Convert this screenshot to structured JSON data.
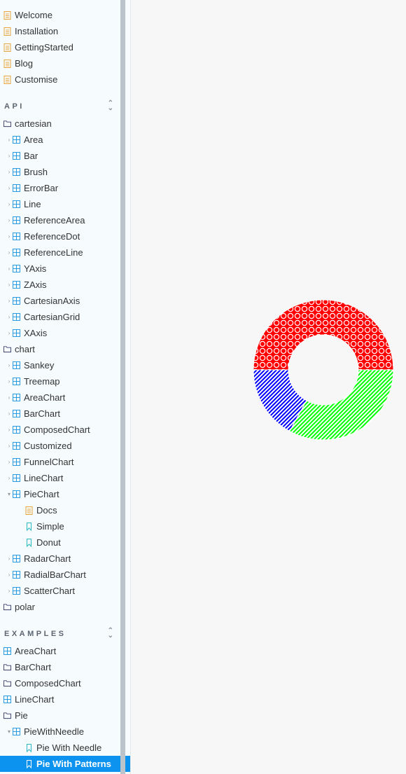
{
  "sidebar": {
    "top_items": [
      {
        "label": "Welcome",
        "icon": "document-icon"
      },
      {
        "label": "Installation",
        "icon": "document-icon"
      },
      {
        "label": "GettingStarted",
        "icon": "document-icon"
      },
      {
        "label": "Blog",
        "icon": "document-icon"
      },
      {
        "label": "Customise",
        "icon": "document-icon"
      }
    ],
    "api_section": "API",
    "cartesian_label": "cartesian",
    "cartesian_items": [
      "Area",
      "Bar",
      "Brush",
      "ErrorBar",
      "Line",
      "ReferenceArea",
      "ReferenceDot",
      "ReferenceLine",
      "YAxis",
      "ZAxis",
      "CartesianAxis",
      "CartesianGrid",
      "XAxis"
    ],
    "chart_label": "chart",
    "chart_items_before": [
      "Sankey",
      "Treemap",
      "AreaChart",
      "BarChart",
      "ComposedChart",
      "Customized",
      "FunnelChart",
      "LineChart"
    ],
    "piechart_label": "PieChart",
    "piechart_children": [
      {
        "label": "Docs",
        "icon": "document-icon"
      },
      {
        "label": "Simple",
        "icon": "bookmark-icon"
      },
      {
        "label": "Donut",
        "icon": "bookmark-icon"
      }
    ],
    "chart_items_after": [
      "RadarChart",
      "RadialBarChart",
      "ScatterChart"
    ],
    "polar_label": "polar",
    "examples_section": "EXAMPLES",
    "examples_items": [
      {
        "label": "AreaChart",
        "icon": "component-icon"
      },
      {
        "label": "BarChart",
        "icon": "folder-icon"
      },
      {
        "label": "ComposedChart",
        "icon": "folder-icon"
      },
      {
        "label": "LineChart",
        "icon": "component-icon"
      },
      {
        "label": "Pie",
        "icon": "folder-icon"
      }
    ],
    "pie_with_needle_group": "PieWithNeedle",
    "pie_children": [
      "Pie With Needle",
      "Pie With Patterns"
    ]
  },
  "chart_data": {
    "type": "pie",
    "values": [
      50,
      17,
      33
    ],
    "colors": [
      "#ff0000",
      "#0000ff",
      "#00ff00"
    ],
    "patterns": [
      "circles",
      "diagonal-stripes",
      "diagonal-stripes"
    ],
    "inner_radius_ratio": 0.5
  }
}
